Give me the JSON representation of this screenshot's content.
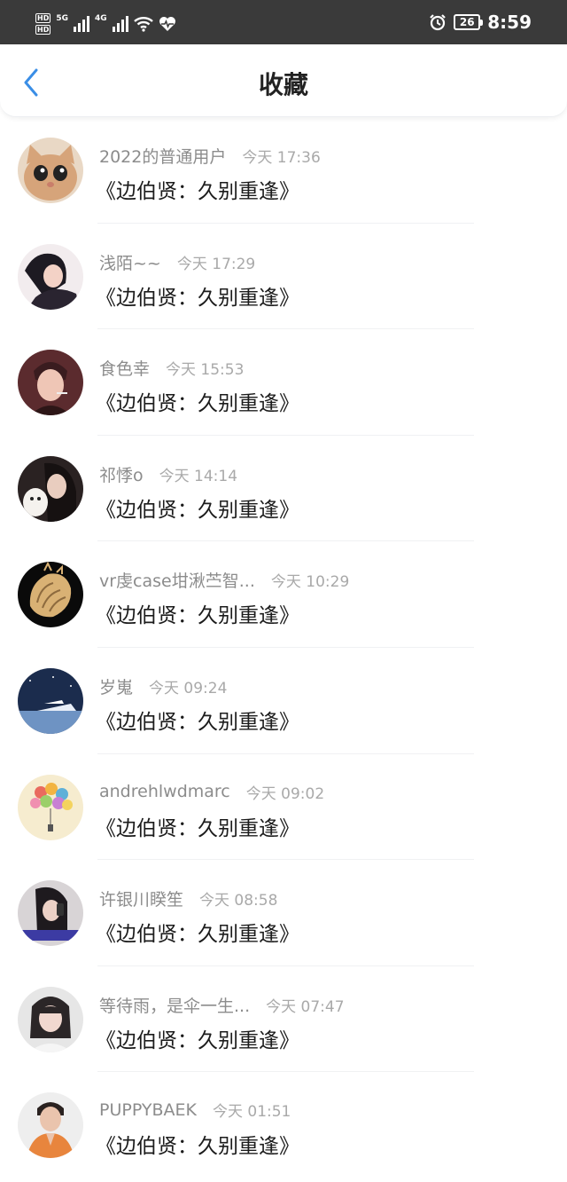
{
  "status_bar": {
    "hd1": "HD",
    "hd2": "HD",
    "net1": "5G",
    "net2": "4G",
    "battery": "26",
    "time": "8:59",
    "icons": [
      "signal-icon",
      "wifi-icon",
      "heart-rate-icon",
      "alarm-icon",
      "battery-icon"
    ]
  },
  "header": {
    "title": "收藏",
    "back_icon": "chevron-left-icon",
    "accent_color": "#3a8ee6"
  },
  "items": [
    {
      "name": "2022的普通用户",
      "time": "今天 17:36",
      "title": "《边伯贤：久别重逢》",
      "avatar": "cat-avatar"
    },
    {
      "name": "浅陌~~",
      "time": "今天 17:29",
      "title": "《边伯贤：久别重逢》",
      "avatar": "girl-avatar"
    },
    {
      "name": "食色幸",
      "time": "今天 15:53",
      "title": "《边伯贤：久别重逢》",
      "avatar": "man-smoking-avatar"
    },
    {
      "name": "祁悸o",
      "time": "今天 14:14",
      "title": "《边伯贤：久别重逢》",
      "avatar": "girl-with-dog-avatar"
    },
    {
      "name": "vr虔case坩湫苎智...",
      "time": "今天 10:29",
      "title": "《边伯贤：久别重逢》",
      "avatar": "seashell-avatar"
    },
    {
      "name": "岁嵬",
      "time": "今天 09:24",
      "title": "《边伯贤：久别重逢》",
      "avatar": "night-ship-avatar"
    },
    {
      "name": "andrehlwdmarc",
      "time": "今天 09:02",
      "title": "《边伯贤：久别重逢》",
      "avatar": "balloons-avatar"
    },
    {
      "name": "许银川睽笙",
      "time": "今天 08:58",
      "title": "《边伯贤：久别重逢》",
      "avatar": "girl-phone-avatar"
    },
    {
      "name": "等待雨，是伞一生...",
      "time": "今天 07:47",
      "title": "《边伯贤：久别重逢》",
      "avatar": "girl-portrait-avatar"
    },
    {
      "name": "PUPPYBAEK",
      "time": "今天 01:51",
      "title": "《边伯贤：久别重逢》",
      "avatar": "man-orange-shirt-avatar"
    }
  ]
}
